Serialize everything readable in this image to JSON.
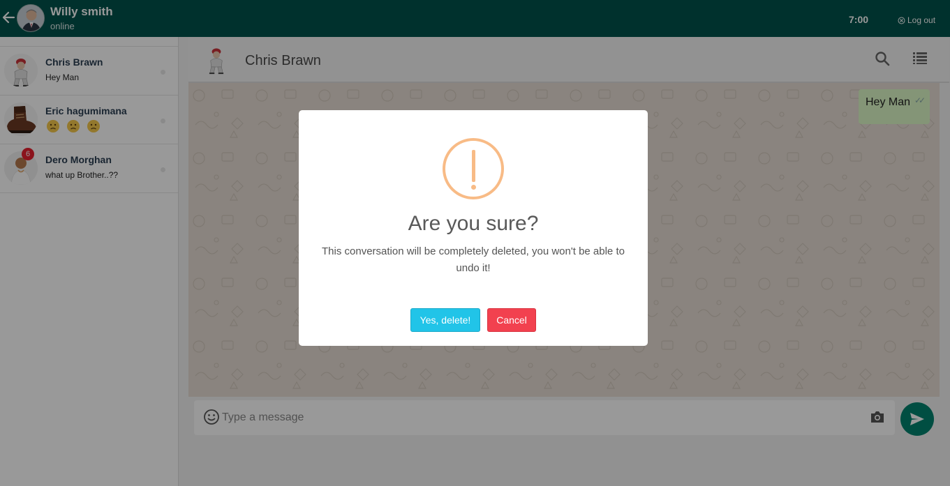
{
  "user": {
    "name": "Willy smith",
    "status": "online"
  },
  "topbar": {
    "time": "7:00",
    "logout_label": "Log out"
  },
  "contacts": [
    {
      "name": "Chris Brawn",
      "last_message": "Hey Man",
      "unread": ""
    },
    {
      "name": "Eric hagumimana",
      "last_message": "",
      "emojis": [
        "confused-face",
        "confused-face",
        "confused-face"
      ],
      "unread": ""
    },
    {
      "name": "Dero Morghan",
      "last_message": "what up Brother..??",
      "unread": "6"
    }
  ],
  "chat": {
    "name": "Chris Brawn",
    "messages": [
      {
        "text": "Hey Man",
        "ticks": "✓✓"
      }
    ]
  },
  "composer": {
    "placeholder": "Type a message"
  },
  "dialog": {
    "title": "Are you sure?",
    "text": "This conversation will be completely deleted, you won't be able to undo it!",
    "confirm_label": "Yes, delete!",
    "cancel_label": "Cancel"
  },
  "colors": {
    "header": "#00524b",
    "accent": "#00826e",
    "warning": "#f8bb86",
    "confirm": "#21c4e8",
    "cancel": "#f2414f",
    "badge": "#e8212f"
  }
}
